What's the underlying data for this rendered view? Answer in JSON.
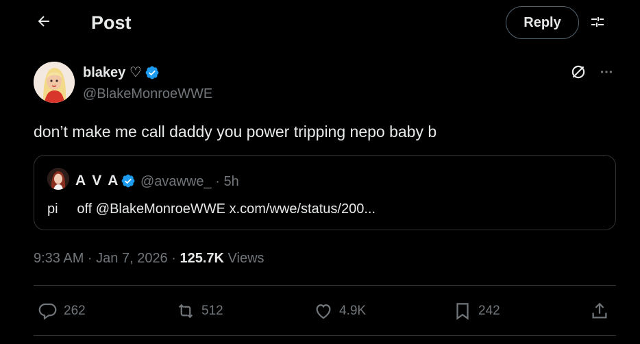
{
  "header": {
    "title": "Post",
    "reply_label": "Reply",
    "back_icon": "arrow-left-icon",
    "settings_icon": "adjust-icon"
  },
  "post": {
    "author_name": "blakey ♡",
    "author_handle": "@BlakeMonroeWWE",
    "text": "don’t make me call daddy you power tripping nepo baby b",
    "verified_color": "#1d9bf0",
    "timestamp": "9:33 AM · Jan 7, 2026 · ",
    "views_count": "125.7K",
    "views_label": " Views"
  },
  "quote": {
    "author_name": "A V A",
    "author_handle_time": "@avawwe_ · 5h",
    "text": "pi     off @BlakeMonroeWWE x.com/wwe/status/200..."
  },
  "actions": {
    "replies": "262",
    "reposts": "512",
    "likes": "4.9K",
    "bookmarks": "242"
  },
  "colors": {
    "background": "#000000",
    "text_primary": "#e7e9ea",
    "text_secondary": "#71767b",
    "border": "#2f3336"
  }
}
